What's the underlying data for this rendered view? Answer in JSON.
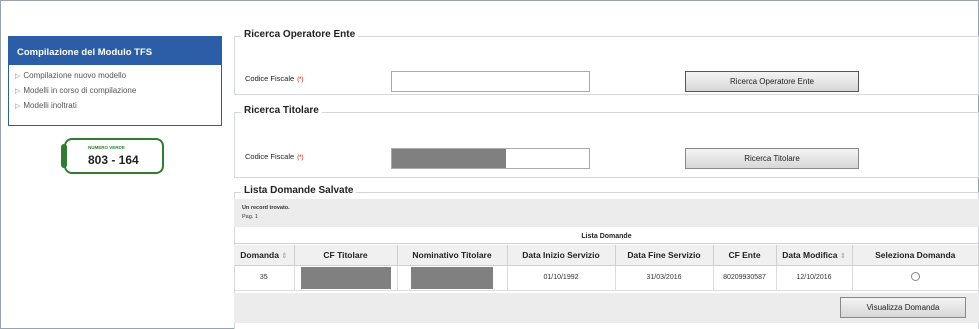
{
  "sidebar": {
    "title": "Compilazione del Modulo TFS",
    "items": [
      {
        "label": "Compilazione nuovo modello"
      },
      {
        "label": "Modelli in corso di compilazione"
      },
      {
        "label": "Modelli inoltrati"
      }
    ]
  },
  "numero_verde": {
    "label": "NUMERO VERDE",
    "number": "803 - 164"
  },
  "ricerca_operatore": {
    "legend": "Ricerca Operatore Ente",
    "field_label": "Codice Fiscale",
    "required_mark": "(*)",
    "value": "",
    "button": "Ricerca Operatore Ente"
  },
  "ricerca_titolare": {
    "legend": "Ricerca Titolare",
    "field_label": "Codice Fiscale",
    "required_mark": "(*)",
    "button": "Ricerca Titolare"
  },
  "lista": {
    "legend": "Lista Domande Salvate",
    "records_text": "Un record trovato.",
    "page_text": "Pag. 1",
    "caption": "Lista Domande",
    "columns": [
      "Domanda",
      "CF Titolare",
      "Nominativo Titolare",
      "Data Inizio Servizio",
      "Data Fine Servizio",
      "CF Ente",
      "Data Modifica",
      "Seleziona Domanda"
    ],
    "rows": [
      {
        "domanda": "35",
        "data_inizio": "01/10/1992",
        "data_fine": "31/03/2016",
        "cf_ente": "80209930587",
        "data_modifica": "12/10/2016"
      }
    ],
    "button": "Visualizza Domanda"
  },
  "colors": {
    "sidebar_header": "#2b5ea6",
    "verde": "#2e7d32",
    "redaction": "#808080"
  }
}
